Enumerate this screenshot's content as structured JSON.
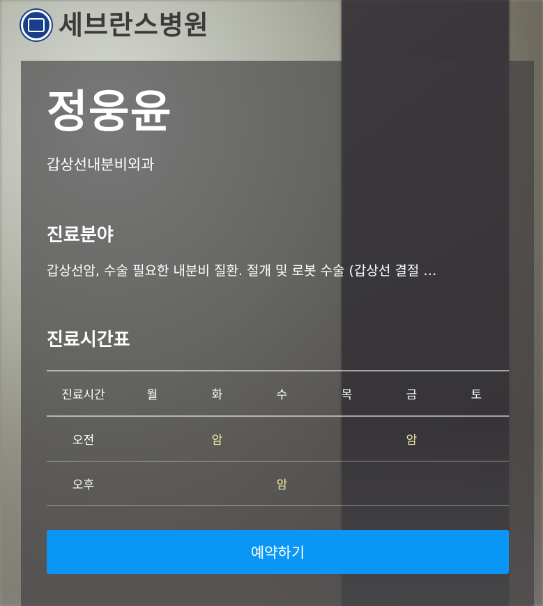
{
  "header": {
    "logo_text": "세브란스병원",
    "emblem_icon": "yonsei-emblem-icon"
  },
  "doctor": {
    "name": "정웅윤",
    "department": "갑상선내분비외과"
  },
  "specialty": {
    "title": "진료분야",
    "text": "갑상선암, 수술 필요한 내분비 질환. 절개 및 로봇 수술 (갑상선 결절 …"
  },
  "schedule": {
    "title": "진료시간표",
    "headers": [
      "진료시간",
      "월",
      "화",
      "수",
      "목",
      "금",
      "토"
    ],
    "rows": [
      {
        "label": "오전",
        "cells": [
          "",
          "암",
          "",
          "",
          "암",
          ""
        ]
      },
      {
        "label": "오후",
        "cells": [
          "",
          "",
          "암",
          "",
          "",
          ""
        ]
      }
    ]
  },
  "actions": {
    "reserve_label": "예약하기"
  },
  "colors": {
    "accent": "#0a96f5",
    "mark": "#f6e7a6",
    "logo_blue": "#1a3f8a"
  }
}
